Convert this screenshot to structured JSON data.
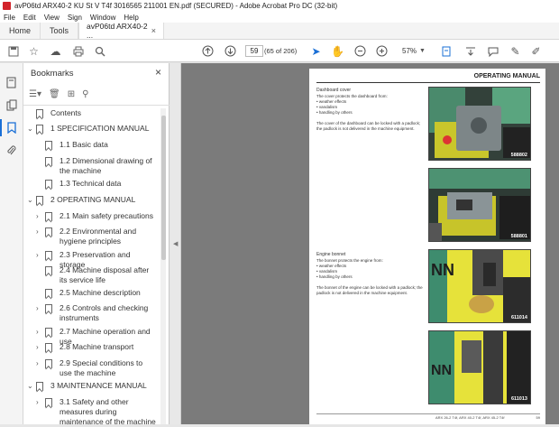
{
  "window": {
    "title": "avP06td ARX40-2 KU St V T4f 3016565 211001 EN.pdf (SECURED) - Adobe Acrobat Pro DC (32-bit)"
  },
  "menu": [
    "File",
    "Edit",
    "View",
    "Sign",
    "Window",
    "Help"
  ],
  "tabs": {
    "home": "Home",
    "tools": "Tools",
    "doc": "avP06td ARX40-2 ..."
  },
  "toolbar": {
    "page_current": "59",
    "page_of": "(65 of 206)",
    "zoom": "57%"
  },
  "bookmarks": {
    "header": "Bookmarks",
    "items": [
      {
        "label": "Contents",
        "level": 0,
        "expandable": false
      },
      {
        "label": "1 SPECIFICATION MANUAL",
        "level": 0,
        "expandable": true,
        "expanded": true
      },
      {
        "label": "1.1 Basic data",
        "level": 1,
        "expandable": false
      },
      {
        "label": "1.2 Dimensional drawing of the machine",
        "level": 1,
        "expandable": false
      },
      {
        "label": "1.3 Technical data",
        "level": 1,
        "expandable": false
      },
      {
        "label": "2 OPERATING MANUAL",
        "level": 0,
        "expandable": true,
        "expanded": true
      },
      {
        "label": "2.1 Main safety precautions",
        "level": 1,
        "expandable": true
      },
      {
        "label": "2.2 Environmental and hygiene principles",
        "level": 1,
        "expandable": true
      },
      {
        "label": "2.3 Preservation and storage",
        "level": 1,
        "expandable": true
      },
      {
        "label": "2.4 Machine disposal after its service life",
        "level": 1,
        "expandable": false
      },
      {
        "label": "2.5 Machine description",
        "level": 1,
        "expandable": false
      },
      {
        "label": "2.6 Controls and checking instruments",
        "level": 1,
        "expandable": true
      },
      {
        "label": "2.7 Machine operation and use",
        "level": 1,
        "expandable": true
      },
      {
        "label": "2.8 Machine transport",
        "level": 1,
        "expandable": true
      },
      {
        "label": "2.9 Special conditions to use the machine",
        "level": 1,
        "expandable": true
      },
      {
        "label": "3 MAINTENANCE MANUAL",
        "level": 0,
        "expandable": true,
        "expanded": true
      },
      {
        "label": "3.1 Safety and other measures during maintenance of the machine",
        "level": 1,
        "expandable": true
      }
    ]
  },
  "page": {
    "header": "OPERATING MANUAL",
    "dashboard": {
      "heading": "Dashboard cover",
      "intro": "The cover protects the dashboard from:",
      "bullets": [
        "weather effects",
        "vandalism",
        "handling by others"
      ],
      "note": "The cover of the dashboard can be locked with a padlock; the padlock is not delivered in the machine equipment."
    },
    "bonnet": {
      "heading": "Engine bonnet",
      "intro": "The bonnet protects the engine from:",
      "bullets": [
        "weather effects",
        "vandalism",
        "handling by others"
      ],
      "note": "The bonnet of the engine can be locked with a padlock; the padlock is not delivered in the machine equipment."
    },
    "photos": [
      "588802",
      "588801",
      "611014",
      "611013"
    ],
    "footer": "ARX 26-2 T4f, ARX 40-2 T4f, ARX 45-2 T4f",
    "page_number": "59"
  },
  "colors": {
    "accent": "#1a6fd6",
    "brand_red": "#d2232a",
    "photo_yellow": "#e6e23a",
    "photo_green": "#3e8c6e"
  }
}
